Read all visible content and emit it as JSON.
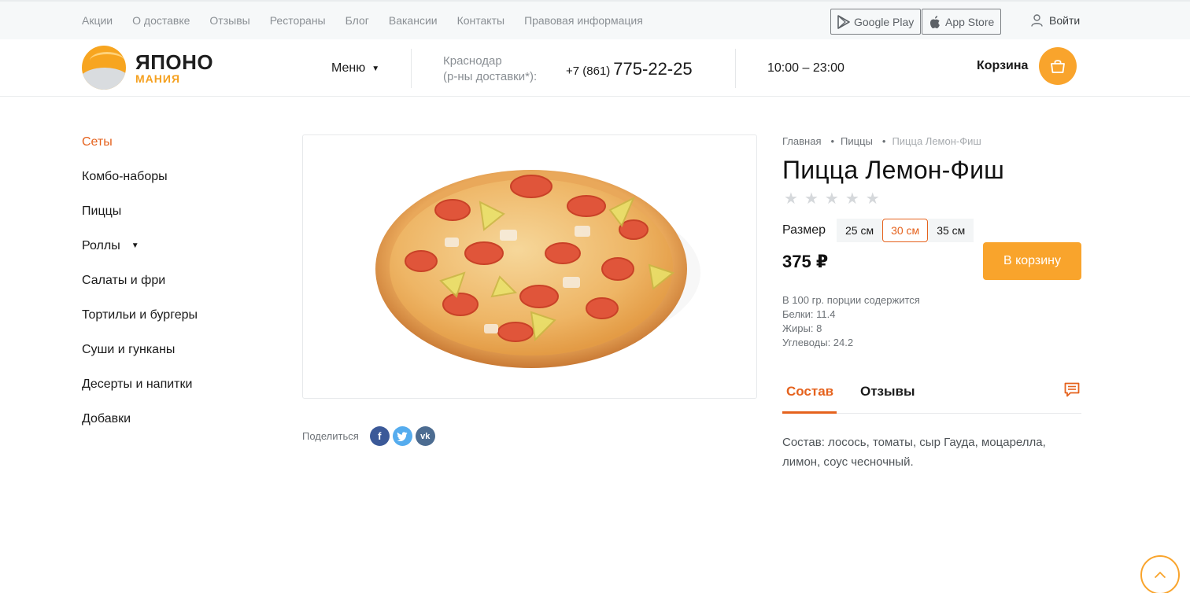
{
  "topnav": {
    "links": [
      "Акции",
      "О доставке",
      "Отзывы",
      "Рестораны",
      "Блог",
      "Вакансии",
      "Контакты",
      "Правовая информация"
    ],
    "google_play": "Google Play",
    "app_store": "App Store",
    "login": "Войти"
  },
  "header": {
    "logo_line1": "ЯПОНО",
    "logo_line2": "МАНИЯ",
    "menu_label": "Меню",
    "city": "Краснодар",
    "city_note": "(р-ны доставки*):",
    "phone_prefix": "+7 (861)",
    "phone_number": "775-22-25",
    "hours": "10:00 – 23:00",
    "cart_label": "Корзина"
  },
  "sidebar": {
    "items": [
      {
        "label": "Сеты",
        "active": true
      },
      {
        "label": "Комбо-наборы"
      },
      {
        "label": "Пиццы"
      },
      {
        "label": "Роллы",
        "has_dropdown": true
      },
      {
        "label": "Салаты и фри"
      },
      {
        "label": "Тортильи и бургеры"
      },
      {
        "label": "Суши и гунканы"
      },
      {
        "label": "Десерты и напитки"
      },
      {
        "label": "Добавки"
      }
    ]
  },
  "share": {
    "label": "Поделиться",
    "networks": [
      "facebook",
      "twitter",
      "vk"
    ]
  },
  "product": {
    "breadcrumb": [
      "Главная",
      "Пиццы",
      "Пицца Лемон-Фиш"
    ],
    "title": "Пицца Лемон-Фиш",
    "rating": 0,
    "rating_max": 5,
    "size_label": "Размер",
    "sizes": [
      "25 см",
      "30 см",
      "35 см"
    ],
    "selected_size": "30 см",
    "price": "375 ₽",
    "buy_label": "В корзину",
    "nutrition": {
      "heading": "В 100 гр. порции содержится",
      "protein": "Белки: 11.4",
      "fat": "Жиры: 8",
      "carbs": "Углеводы: 24.2"
    },
    "tabs": [
      "Состав",
      "Отзывы"
    ],
    "active_tab": "Состав",
    "composition": "Состав: лосось, томаты, сыр Гауда, моцарелла, лимон, соус чесночный."
  },
  "colors": {
    "accent": "#f9a42c",
    "active_text": "#e5621d"
  },
  "icons": [
    "google-play-icon",
    "apple-icon",
    "user-icon",
    "cart-bag-icon",
    "comment-icon",
    "arrow-up-icon"
  ]
}
